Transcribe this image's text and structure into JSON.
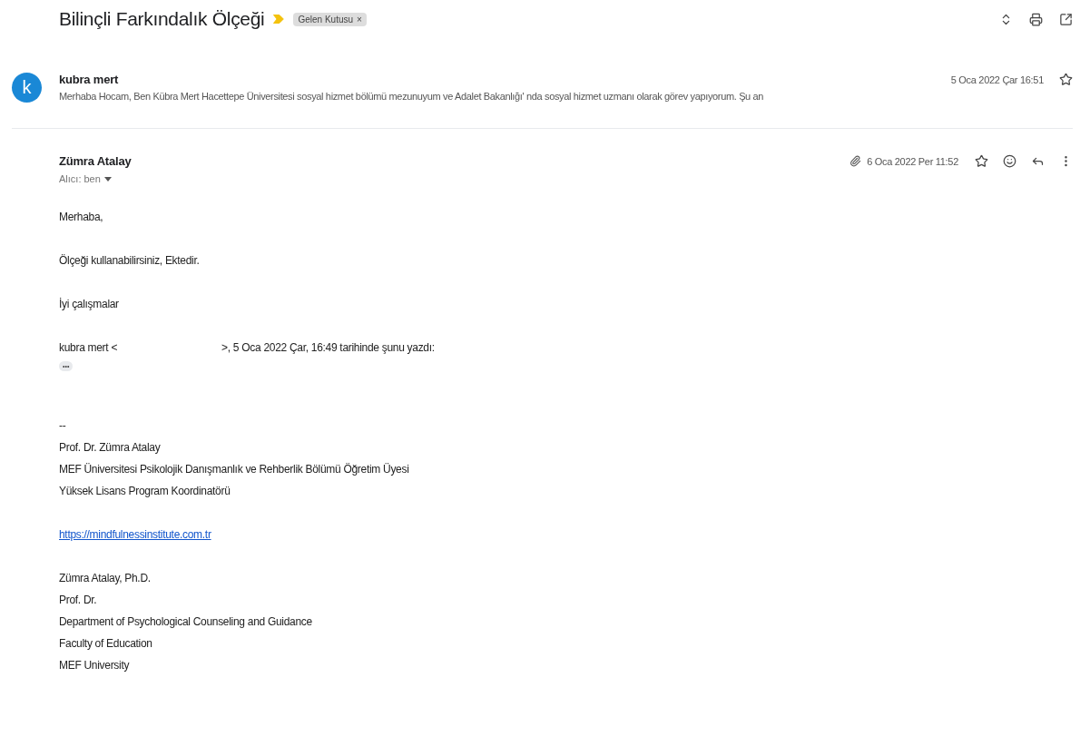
{
  "thread": {
    "subject": "Bilinçli Farkındalık Ölçeği",
    "important": true,
    "label": "Gelen Kutusu",
    "label_close": "×"
  },
  "messages": [
    {
      "kind": "collapsed",
      "avatar": "k",
      "sender": "kubra mert",
      "snippet": "Merhaba Hocam, Ben Kübra Mert Hacettepe Üniversitesi sosyal hizmet bölümü mezunuyum ve Adalet Bakanlığı' nda sosyal hizmet uzmanı olarak görev yapıyorum. Şu an",
      "date": "5 Oca 2022 Çar 16:51",
      "starred": false
    },
    {
      "kind": "expanded",
      "sender": "Zümra Atalay",
      "recipient": "Alıcı: ben",
      "date": "6 Oca 2022 Per 11:52",
      "has_attachment": true,
      "starred": false,
      "body": [
        {
          "kind": "text",
          "lines": [
            "Merhaba,"
          ]
        },
        {
          "kind": "text",
          "lines": [
            "Ölçeği kullanabilirsiniz, Ektedir."
          ]
        },
        {
          "kind": "text",
          "lines": [
            "İyi çalışmalar"
          ]
        },
        {
          "kind": "quote",
          "before": "kubra mert <",
          "after": ">, 5 Oca 2022 Çar, 16:49 tarihinde şunu yazdı:",
          "toggle": "•••"
        },
        {
          "kind": "text",
          "lines": [
            "--",
            "Prof. Dr. Zümra Atalay",
            "MEF Üniversitesi Psikolojik Danışmanlık ve Rehberlik Bölümü Öğretim Üyesi",
            "Yüksek Lisans Program Koordinatörü"
          ]
        },
        {
          "kind": "link",
          "lines": [
            "https://mindfulnessinstitute.com.tr"
          ]
        },
        {
          "kind": "text",
          "lines": [
            "Zümra Atalay, Ph.D.",
            "Prof. Dr.",
            "Department of Psychological Counseling and Guidance",
            "Faculty of Education",
            "MEF University"
          ]
        }
      ]
    }
  ]
}
